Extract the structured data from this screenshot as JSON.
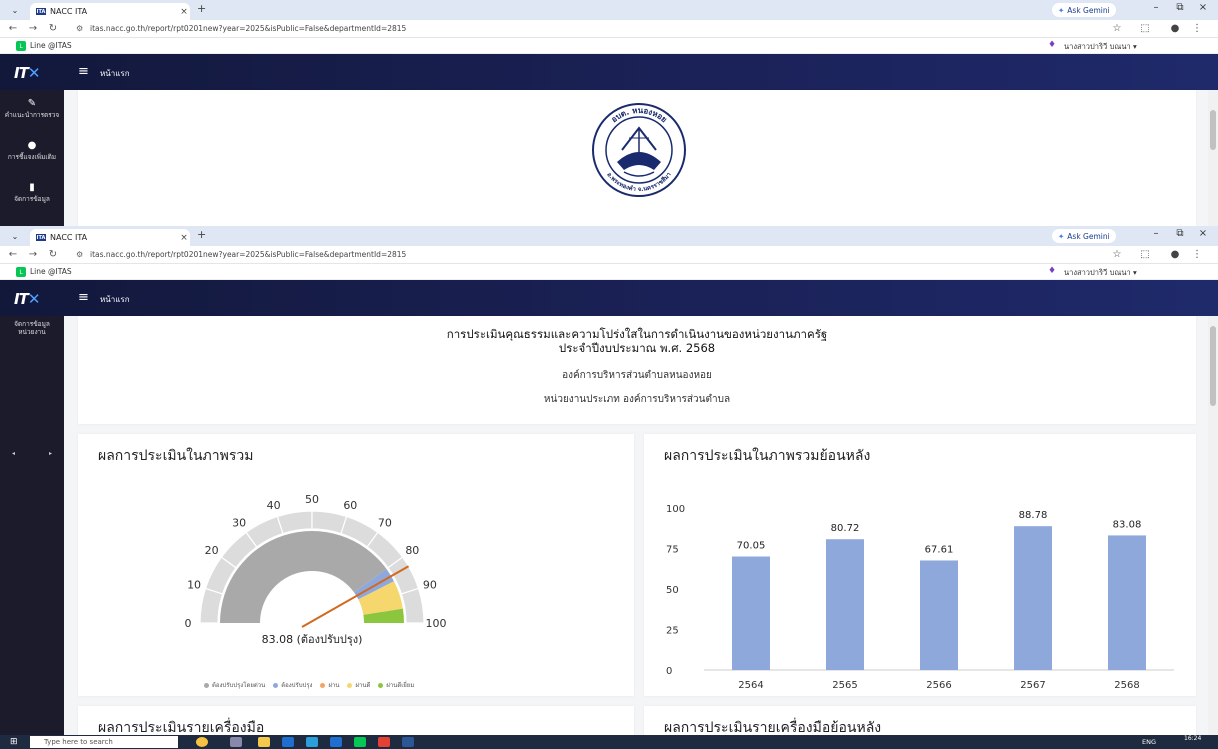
{
  "browser": {
    "tab_title": "NACC ITA",
    "tab_favicon": "ITA",
    "new_tab": "+",
    "gemini_label": "Ask Gemini",
    "url": "itas.nacc.go.th/report/rpt0201new?year=2025&isPublic=False&departmentId=2815",
    "bookmark_label": "Line @ITAS",
    "user_name": "นางสาวปาริวี บณนา ▾"
  },
  "app": {
    "logo_text": "IT",
    "home_label": "หน้าแรก",
    "sidebar_top": [
      {
        "label": "คำแนะนำการตรวจ",
        "icon": "edit-icon"
      },
      {
        "label": "การชี้แจงเพิ่มเติม",
        "icon": "user-icon"
      },
      {
        "label": "จัดการข้อมูล",
        "icon": "clipboard-icon"
      }
    ],
    "sidebar_bottom": [
      {
        "label": "จัดการข้อมูลหน่วยงาน",
        "icon": "clipboard-icon"
      }
    ]
  },
  "seal": {
    "top_text": "อบต. หนองหอย",
    "bottom_text": "อ.พระทองคำ จ.นครราชสีมา"
  },
  "header": {
    "title_line1": "การประเมินคุณธรรมและความโปร่งใสในการดำเนินงานของหน่วยงานภาครัฐ",
    "title_line2": "ประจำปีงบประมาณ พ.ศ. 2568",
    "org_name": "องค์การบริหารส่วนตำบลหนองหอย",
    "org_type": "หน่วยงานประเภท องค์การบริหารส่วนตำบล"
  },
  "overall_card": {
    "title": "ผลการประเมินในภาพรวม"
  },
  "history_card": {
    "title": "ผลการประเมินในภาพรวมย้อนหลัง"
  },
  "tool_card": {
    "title": "ผลการประเมินรายเครื่องมือ"
  },
  "tool_history_card": {
    "title": "ผลการประเมินรายเครื่องมือย้อนหลัง"
  },
  "chart_data": [
    {
      "type": "gauge",
      "value": 83.08,
      "value_label": "83.08 (ต้องปรับปรุง)",
      "range": [
        0,
        100
      ],
      "ticks": [
        0,
        10,
        20,
        30,
        40,
        50,
        60,
        70,
        80,
        90,
        100
      ],
      "bands": [
        {
          "name": "ต้องปรับปรุงโดยด่วน",
          "from": 0,
          "to": 80,
          "color": "#a9a9a9"
        },
        {
          "name": "ต้องปรับปรุง",
          "from": 80,
          "to": 85,
          "color": "#8fa8dc"
        },
        {
          "name": "ผ่าน",
          "from": 85,
          "to": 95,
          "color": "#f5d76e"
        },
        {
          "name": "ผ่านดีเยี่ยม",
          "from": 95,
          "to": 100,
          "color": "#8cc63f"
        }
      ],
      "legend": [
        {
          "name": "ต้องปรับปรุงโดยด่วน",
          "color": "#a9a9a9"
        },
        {
          "name": "ต้องปรับปรุง",
          "color": "#8fa8dc"
        },
        {
          "name": "ผ่าน",
          "color": "#f4a460"
        },
        {
          "name": "ผ่านดี",
          "color": "#f5d76e"
        },
        {
          "name": "ผ่านดีเยี่ยม",
          "color": "#8cc63f"
        }
      ],
      "needle_color": "#d2691e"
    },
    {
      "type": "bar",
      "categories": [
        "2564",
        "2565",
        "2566",
        "2567",
        "2568"
      ],
      "values": [
        70.05,
        80.72,
        67.61,
        88.78,
        83.08
      ],
      "ylim": [
        0,
        100
      ],
      "yticks": [
        0,
        25,
        50,
        75,
        100
      ],
      "bar_color": "#8fa8dc",
      "grid": false
    }
  ],
  "taskbar": {
    "search_placeholder": "Type here to search",
    "tray_text": "ENG",
    "time": "16:24"
  }
}
